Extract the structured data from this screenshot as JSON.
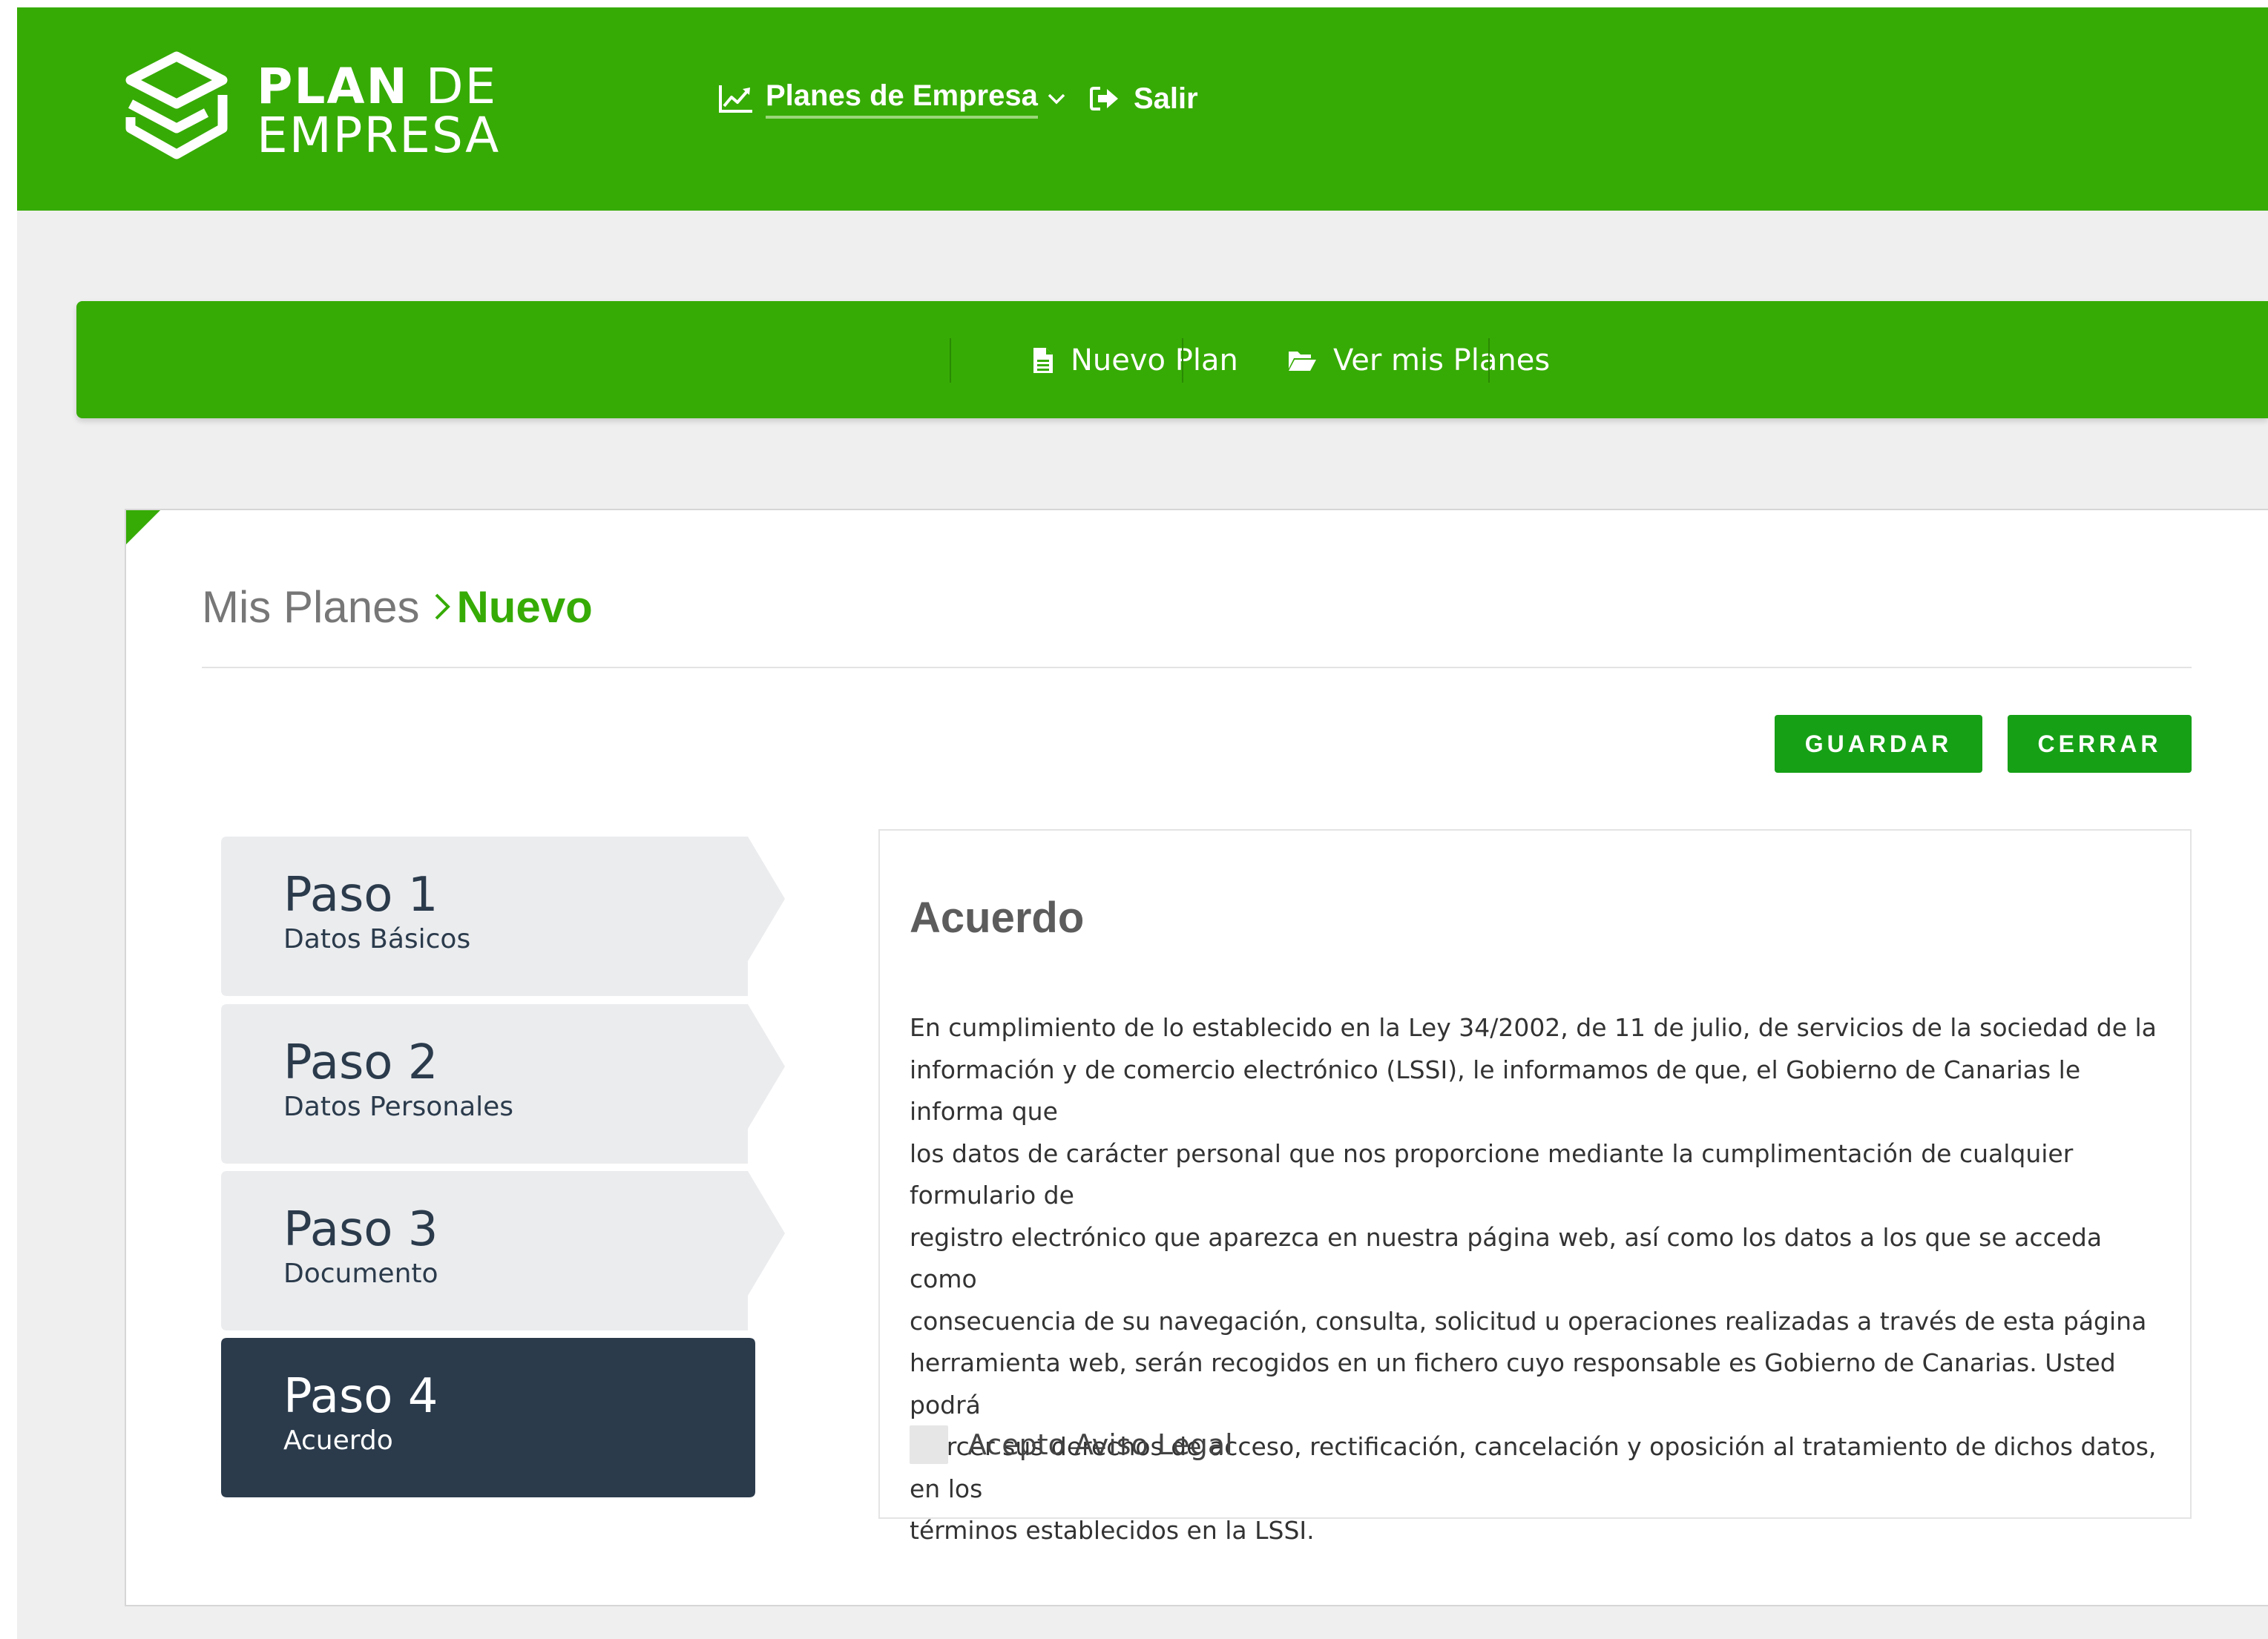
{
  "header": {
    "logo_line1_bold": "PLAN",
    "logo_line1_light": "DE",
    "logo_line2": "EMPRESA",
    "nav": {
      "planes_label": "Planes de Empresa",
      "planes_icon": "line-chart-icon",
      "salir_label": "Salir",
      "salir_icon": "sign-out-icon"
    }
  },
  "subnav": {
    "nuevo_label": "Nuevo Plan",
    "nuevo_icon": "document-icon",
    "ver_label": "Ver mis Planes",
    "ver_icon": "folder-open-icon"
  },
  "breadcrumb": {
    "root": "Mis Planes",
    "current": "Nuevo"
  },
  "actions": {
    "guardar": "GUARDAR",
    "cerrar": "CERRAR"
  },
  "steps": [
    {
      "title": "Paso 1",
      "subtitle": "Datos Básicos",
      "active": false
    },
    {
      "title": "Paso 2",
      "subtitle": "Datos Personales",
      "active": false
    },
    {
      "title": "Paso 3",
      "subtitle": "Documento",
      "active": false
    },
    {
      "title": "Paso 4",
      "subtitle": "Acuerdo",
      "active": true
    }
  ],
  "panel": {
    "title": "Acuerdo",
    "lines": [
      "En cumplimiento de lo establecido en la Ley 34/2002, de 11 de julio, de servicios de la sociedad de la",
      "información y de comercio electrónico (LSSI), le informamos de que, el Gobierno de Canarias le informa que",
      "los datos de carácter personal que nos proporcione mediante la cumplimentación de cualquier formulario de",
      "registro electrónico que aparezca en nuestra página web, así como los datos a los que se acceda como",
      "consecuencia de su navegación, consulta, solicitud u operaciones realizadas a través de esta página",
      "herramienta web, serán recogidos en un fichero cuyo responsable es Gobierno de Canarias. Usted podrá",
      "ejercer sus derechos de acceso, rectificación, cancelación y oposición al tratamiento de dichos datos, en los",
      "términos establecidos en la LSSI."
    ],
    "checkbox_label": "Acepto Aviso Legal",
    "checkbox_checked": false
  },
  "colors": {
    "brand_green": "#36ab05",
    "button_green": "#16a016",
    "step_inactive": "#ebecee",
    "step_active": "#2b3b4c"
  }
}
